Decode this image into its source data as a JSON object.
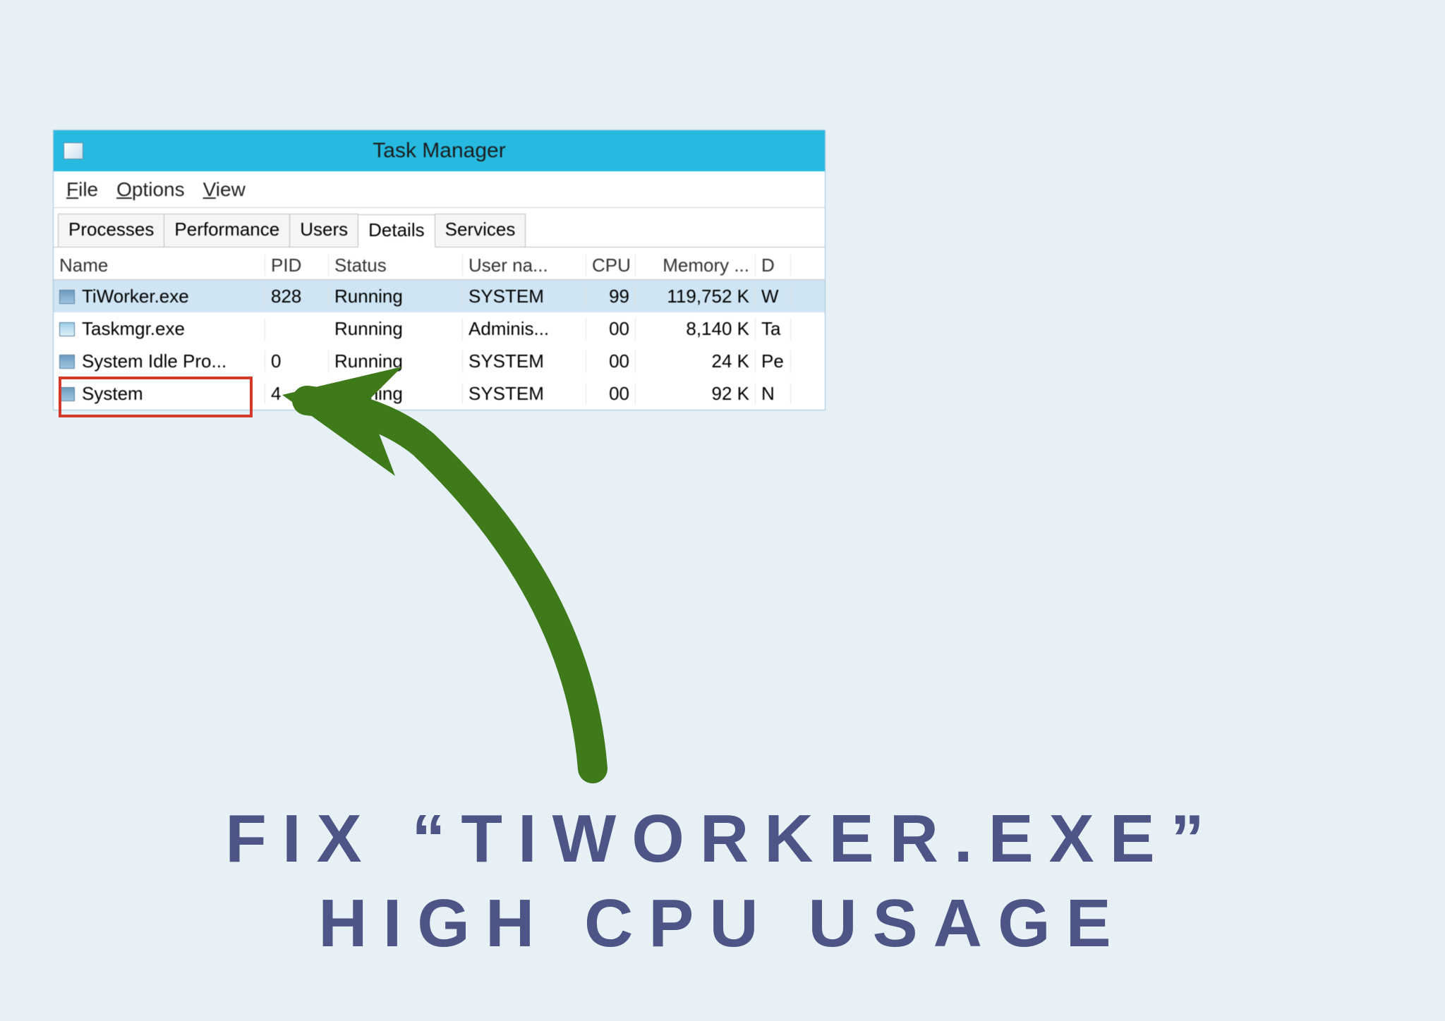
{
  "window": {
    "title": "Task Manager"
  },
  "menu": {
    "file": "File",
    "options": "Options",
    "view": "View"
  },
  "tabs": {
    "processes": "Processes",
    "performance": "Performance",
    "users": "Users",
    "details": "Details",
    "services": "Services"
  },
  "columns": {
    "name": "Name",
    "pid": "PID",
    "status": "Status",
    "user": "User na...",
    "cpu": "CPU",
    "memory": "Memory ...",
    "d": "D"
  },
  "rows": [
    {
      "name": "TiWorker.exe",
      "pid": "828",
      "status": "Running",
      "user": "SYSTEM",
      "cpu": "99",
      "memory": "119,752 K",
      "d": "W"
    },
    {
      "name": "Taskmgr.exe",
      "pid": "",
      "status": "Running",
      "user": "Adminis...",
      "cpu": "00",
      "memory": "8,140 K",
      "d": "Ta"
    },
    {
      "name": "System Idle Pro...",
      "pid": "0",
      "status": "Running",
      "user": "SYSTEM",
      "cpu": "00",
      "memory": "24 K",
      "d": "Pe"
    },
    {
      "name": "System",
      "pid": "4",
      "status": "Running",
      "user": "SYSTEM",
      "cpu": "00",
      "memory": "92 K",
      "d": "N"
    }
  ],
  "annotation": {
    "headline_line1": "FIX “TIWORKER.EXE”",
    "headline_line2": "HIGH CPU USAGE",
    "arrow_color": "#3f7a1a",
    "highlight_color": "#d43a2a"
  }
}
